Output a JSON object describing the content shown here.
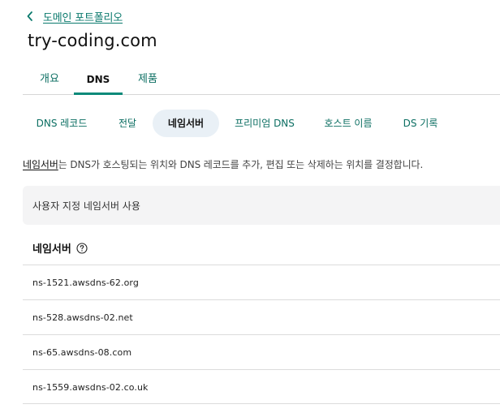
{
  "breadcrumb": {
    "label": "도메인 포트폴리오",
    "icon": "chevron-left-icon"
  },
  "page_title": "try-coding.com",
  "main_tabs": [
    {
      "label": "개요",
      "active": false
    },
    {
      "label": "DNS",
      "active": true
    },
    {
      "label": "제품",
      "active": false
    }
  ],
  "sub_tabs": [
    {
      "label": "DNS 레코드",
      "active": false
    },
    {
      "label": "전달",
      "active": false
    },
    {
      "label": "네임서버",
      "active": true
    },
    {
      "label": "프리미엄 DNS",
      "active": false
    },
    {
      "label": "호스트 이름",
      "active": false
    },
    {
      "label": "DS 기록",
      "active": false
    }
  ],
  "description": {
    "link_text": "네임서버",
    "rest": "는 DNS가 호스팅되는 위치와 DNS 레코드를 추가, 편집 또는 삭제하는 위치를 결정합니다."
  },
  "custom_ns_label": "사용자 지정 네임서버 사용",
  "nameservers": {
    "header": "네임서버",
    "help_icon": "question-circle-icon",
    "items": [
      "ns-1521.awsdns-62.org",
      "ns-528.awsdns-02.net",
      "ns-65.awsdns-08.com",
      "ns-1559.awsdns-02.co.uk"
    ]
  },
  "colors": {
    "accent": "#0b7a6d",
    "tab_underline": "#0b8a7a",
    "active_pill": "#e9f0f6",
    "panel_bg": "#f4f4f5"
  }
}
